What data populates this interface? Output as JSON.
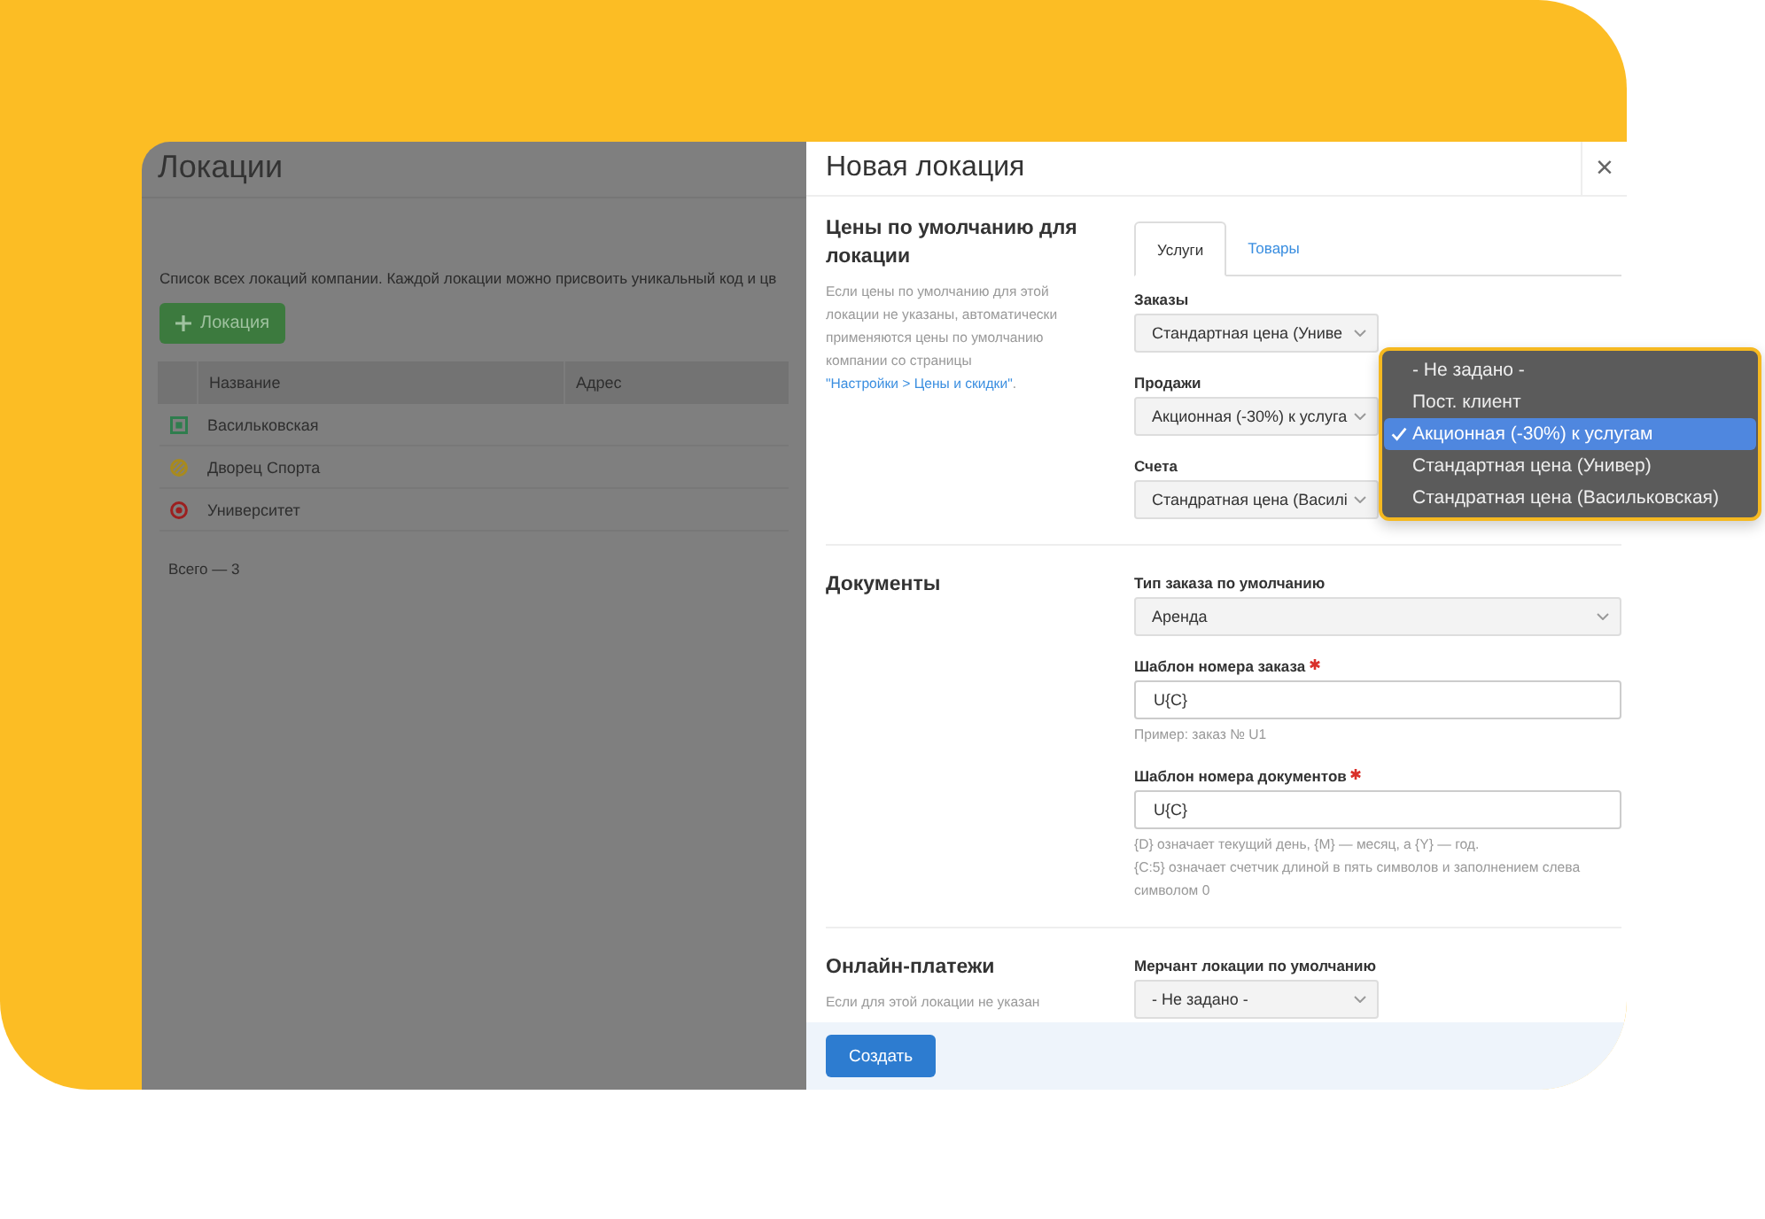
{
  "page": {
    "title": "Локации",
    "description": "Список всех локаций компании. Каждой локации можно присвоить уникальный код и цв",
    "add_button": "Локация",
    "table": {
      "columns": [
        "Название",
        "Адрес"
      ],
      "rows": [
        {
          "name": "Васильковская",
          "kind": "square",
          "color": "#2f7d4e"
        },
        {
          "name": "Дворец Спорта",
          "kind": "hatched",
          "color": "#a88a1e"
        },
        {
          "name": "Университет",
          "kind": "target",
          "color": "#9c1f1f"
        }
      ]
    },
    "total": "Всего — 3"
  },
  "modal": {
    "title": "Новая локация",
    "close": "×",
    "sections": [
      {
        "title": "Цены по умолчанию для локации",
        "description": "Если цены по умолчанию для этой локации не указаны, автоматически применяются цены по умолчанию компании со страницы ",
        "link": "\"Настройки > Цены и скидки\"",
        "after": ".",
        "tabs": [
          {
            "label": "Услуги",
            "selected": true
          },
          {
            "label": "Товары",
            "selected": false
          }
        ],
        "fields": [
          {
            "kind": "select",
            "label": "Заказы",
            "value": "Стандартная цена (Униве",
            "required": false
          },
          {
            "kind": "select",
            "label": "Продажи",
            "value": "Акционная (-30%) к услуга",
            "required": false
          },
          {
            "kind": "select",
            "label": "Счета",
            "value": "Стандратная цена (Василі",
            "required": false
          }
        ]
      },
      {
        "title": "Документы",
        "fields": [
          {
            "kind": "wide-select",
            "label": "Тип заказа по умолчанию",
            "value": "Аренда",
            "required": false
          },
          {
            "kind": "input",
            "label": "Шаблон номера заказа",
            "value": "U{C}",
            "required": true,
            "hints": [
              "Пример: заказ № U1"
            ]
          },
          {
            "kind": "input",
            "label": "Шаблон номера документов",
            "value": "U{C}",
            "required": true,
            "hints": [
              "{D} означает текущий день, {M} — месяц, а {Y} — год.",
              "{C:5} означает счетчик длиной в пять символов и заполнением слева символом 0"
            ]
          }
        ]
      },
      {
        "title": "Онлайн-платежи",
        "description": "Если для этой локации не указан",
        "fields": [
          {
            "kind": "select",
            "label": "Мерчант локации по умолчанию",
            "value": "- Не задано -",
            "required": false
          }
        ]
      }
    ],
    "submit": "Создать"
  },
  "dropdown": {
    "options": [
      {
        "label": "- Не задано -",
        "selected": false
      },
      {
        "label": "Пост. клиент",
        "selected": false
      },
      {
        "label": "Акционная (-30%) к услугам",
        "selected": true
      },
      {
        "label": "Стандартная цена (Универ)",
        "selected": false
      },
      {
        "label": "Стандратная цена (Васильковская)",
        "selected": false
      }
    ]
  }
}
